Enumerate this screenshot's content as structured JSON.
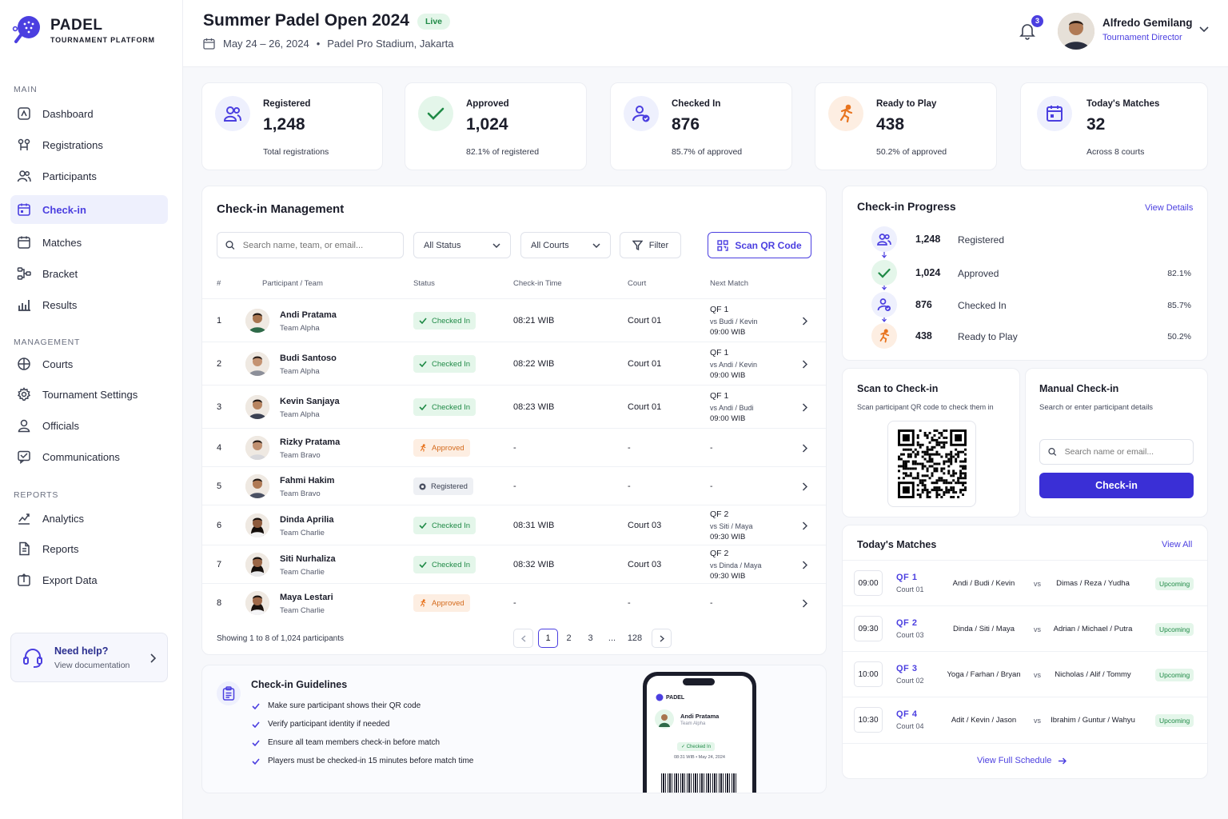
{
  "brand": {
    "name": "PADEL",
    "tagline": "TOURNAMENT PLATFORM",
    "accent": "#4b3fe0"
  },
  "sidebar": {
    "main_title": "MAIN",
    "main_items": [
      {
        "label": "Dashboard",
        "icon": "dashboard-icon"
      },
      {
        "label": "Registrations",
        "icon": "registrations-icon"
      },
      {
        "label": "Participants",
        "icon": "participants-icon"
      },
      {
        "label": "Check-in",
        "icon": "calendar-check-icon",
        "active": true
      },
      {
        "label": "Matches",
        "icon": "calendar-icon"
      },
      {
        "label": "Bracket",
        "icon": "bracket-icon"
      },
      {
        "label": "Results",
        "icon": "bar-chart-icon"
      }
    ],
    "management_title": "MANAGEMENT",
    "management_items": [
      {
        "label": "Courts",
        "icon": "court-icon"
      },
      {
        "label": "Tournament Settings",
        "icon": "gear-icon"
      },
      {
        "label": "Officials",
        "icon": "user-icon"
      },
      {
        "label": "Communications",
        "icon": "message-icon"
      }
    ],
    "reports_title": "REPORTS",
    "reports_items": [
      {
        "label": "Analytics",
        "icon": "analytics-icon"
      },
      {
        "label": "Reports",
        "icon": "document-icon"
      },
      {
        "label": "Export Data",
        "icon": "export-icon"
      }
    ],
    "help": {
      "title": "Need help?",
      "subtitle": "View documentation"
    }
  },
  "header": {
    "title": "Summer Padel Open 2024",
    "live_badge": "Live",
    "dates": "May 24 – 26, 2024",
    "separator": "•",
    "venue": "Padel Pro Stadium, Jakarta",
    "notification_count": "3",
    "user": {
      "name": "Alfredo Gemilang",
      "role": "Tournament Director"
    }
  },
  "stats": [
    {
      "label": "Registered",
      "value": "1,248",
      "sub": "Total registrations",
      "icon": "users-icon",
      "color": "#4b3fe0",
      "bg": "#eef0fd"
    },
    {
      "label": "Approved",
      "value": "1,024",
      "sub": "82.1% of registered",
      "icon": "check-icon",
      "color": "#1f8a46",
      "bg": "#e4f6ea"
    },
    {
      "label": "Checked In",
      "value": "876",
      "sub": "85.7% of approved",
      "icon": "user-check-icon",
      "color": "#4b3fe0",
      "bg": "#eef0fd"
    },
    {
      "label": "Ready to Play",
      "value": "438",
      "sub": "50.2% of approved",
      "icon": "runner-icon",
      "color": "#e8741f",
      "bg": "#fdeee2"
    },
    {
      "label": "Today's Matches",
      "value": "32",
      "sub": "Across 8 courts",
      "icon": "calendar-icon",
      "color": "#4b3fe0",
      "bg": "#eef0fd"
    }
  ],
  "checkin": {
    "title": "Check-in Management",
    "search_placeholder": "Search name, team, or email...",
    "status_filter": "All Status",
    "court_filter": "All Courts",
    "filter_label": "Filter",
    "scan_label": "Scan QR Code",
    "columns": [
      "#",
      "Participant / Team",
      "Status",
      "Check-in Time",
      "Court",
      "Next Match"
    ],
    "rows": [
      {
        "num": "1",
        "name": "Andi Pratama",
        "team": "Team Alpha",
        "status": "Checked In",
        "kind": "checked",
        "time": "08:21 WIB",
        "court": "Court 01",
        "match": "QF 1",
        "vs": "vs Budi / Kevin",
        "mtime": "09:00 WIB"
      },
      {
        "num": "2",
        "name": "Budi Santoso",
        "team": "Team Alpha",
        "status": "Checked In",
        "kind": "checked",
        "time": "08:22 WIB",
        "court": "Court 01",
        "match": "QF 1",
        "vs": "vs Andi / Kevin",
        "mtime": "09:00 WIB"
      },
      {
        "num": "3",
        "name": "Kevin Sanjaya",
        "team": "Team Alpha",
        "status": "Checked In",
        "kind": "checked",
        "time": "08:23 WIB",
        "court": "Court 01",
        "match": "QF 1",
        "vs": "vs Andi / Budi",
        "mtime": "09:00 WIB"
      },
      {
        "num": "4",
        "name": "Rizky Pratama",
        "team": "Team Bravo",
        "status": "Approved",
        "kind": "approved",
        "time": "-",
        "court": "-",
        "match": "-",
        "vs": "",
        "mtime": ""
      },
      {
        "num": "5",
        "name": "Fahmi Hakim",
        "team": "Team Bravo",
        "status": "Registered",
        "kind": "registered",
        "time": "-",
        "court": "-",
        "match": "-",
        "vs": "",
        "mtime": ""
      },
      {
        "num": "6",
        "name": "Dinda Aprilia",
        "team": "Team Charlie",
        "status": "Checked In",
        "kind": "checked",
        "time": "08:31 WIB",
        "court": "Court 03",
        "match": "QF 2",
        "vs": "vs Siti / Maya",
        "mtime": "09:30 WIB"
      },
      {
        "num": "7",
        "name": "Siti Nurhaliza",
        "team": "Team Charlie",
        "status": "Checked In",
        "kind": "checked",
        "time": "08:32 WIB",
        "court": "Court 03",
        "match": "QF 2",
        "vs": "vs Dinda / Maya",
        "mtime": "09:30 WIB"
      },
      {
        "num": "8",
        "name": "Maya Lestari",
        "team": "Team Charlie",
        "status": "Approved",
        "kind": "approved",
        "time": "-",
        "court": "-",
        "match": "-",
        "vs": "",
        "mtime": ""
      }
    ],
    "showing": "Showing 1 to 8 of 1,024 participants",
    "pages": [
      "1",
      "2",
      "3",
      "...",
      "128"
    ]
  },
  "guidelines": {
    "title": "Check-in Guidelines",
    "items": [
      "Make sure participant shows their QR code",
      "Verify participant identity if needed",
      "Ensure all team members check-in before match",
      "Players must be checked-in 15 minutes before match time"
    ],
    "phone": {
      "brand": "PADEL",
      "name": "Andi Pratama",
      "team": "Team Alpha",
      "status": "Checked In",
      "time": "08:31 WIB • May 24, 2024"
    }
  },
  "progress": {
    "title": "Check-in Progress",
    "link": "View Details",
    "items": [
      {
        "value": "1,248",
        "label": "Registered",
        "pct": ""
      },
      {
        "value": "1,024",
        "label": "Approved",
        "pct": "82.1%"
      },
      {
        "value": "876",
        "label": "Checked In",
        "pct": "85.7%"
      },
      {
        "value": "438",
        "label": "Ready to Play",
        "pct": "50.2%"
      }
    ]
  },
  "scan": {
    "title": "Scan to Check-in",
    "subtitle": "Scan participant QR code to check them in"
  },
  "manual": {
    "title": "Manual Check-in",
    "subtitle": "Search or enter participant details",
    "placeholder": "Search name or email...",
    "button": "Check-in"
  },
  "matches": {
    "title": "Today's Matches",
    "link": "View All",
    "items": [
      {
        "time": "09:00",
        "match": "QF  1",
        "court": "Court 01",
        "team_a": "Andi / Budi / Kevin",
        "team_b": "Dimas / Reza / Yudha",
        "status": "Upcoming"
      },
      {
        "time": "09:30",
        "match": "QF  2",
        "court": "Court 03",
        "team_a": "Dinda / Siti / Maya",
        "team_b": "Adrian / Michael / Putra",
        "status": "Upcoming"
      },
      {
        "time": "10:00",
        "match": "QF  3",
        "court": "Court 02",
        "team_a": "Yoga / Farhan / Bryan",
        "team_b": "Nicholas / Alif / Tommy",
        "status": "Upcoming"
      },
      {
        "time": "10:30",
        "match": "QF  4",
        "court": "Court 04",
        "team_a": "Adit / Kevin / Jason",
        "team_b": "Ibrahim / Guntur / Wahyu",
        "status": "Upcoming"
      }
    ],
    "vs": "vs",
    "full_schedule": "View Full Schedule"
  }
}
